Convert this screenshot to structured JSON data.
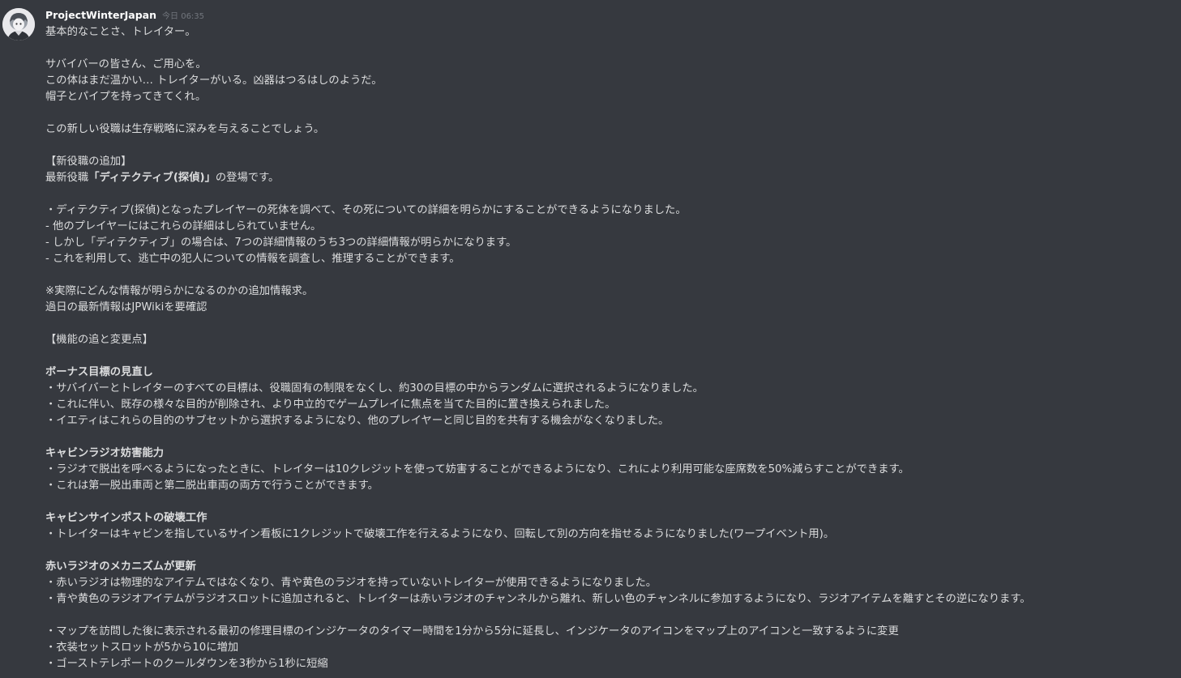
{
  "message": {
    "author": "ProjectWinterJapan",
    "timestamp": "今日 06:35",
    "lines": [
      {
        "text": "基本的なことさ、トレイター。"
      },
      {
        "text": ""
      },
      {
        "text": "サバイバーの皆さん、ご用心を。"
      },
      {
        "text": "この体はまだ温かい… トレイターがいる。凶器はつるはしのようだ。"
      },
      {
        "text": "帽子とパイプを持ってきてくれ。"
      },
      {
        "text": ""
      },
      {
        "text": "この新しい役職は生存戦略に深みを与えることでしょう。"
      },
      {
        "text": ""
      },
      {
        "text": "【新役職の追加】"
      },
      {
        "parts": [
          {
            "text": "最新役職"
          },
          {
            "text": "「ディテクティブ(探偵)」",
            "bold": true
          },
          {
            "text": "の登場です。"
          }
        ]
      },
      {
        "text": ""
      },
      {
        "text": "・ディテクティブ(探偵)となったプレイヤーの死体を調べて、その死についての詳細を明らかにすることができるようになりました。"
      },
      {
        "text": "- 他のプレイヤーにはこれらの詳細はしられていません。"
      },
      {
        "text": "- しかし「ディテクティブ」の場合は、7つの詳細情報のうち3つの詳細情報が明らかになります。"
      },
      {
        "text": "- これを利用して、逃亡中の犯人についての情報を調査し、推理することができます。"
      },
      {
        "text": ""
      },
      {
        "text": "※実際にどんな情報が明らかになるのかの追加情報求。"
      },
      {
        "text": "過日の最新情報はJPWikiを要確認"
      },
      {
        "text": ""
      },
      {
        "text": "【機能の追と変更点】"
      },
      {
        "text": ""
      },
      {
        "text": "ボーナス目標の見直し",
        "bold": true
      },
      {
        "text": "・サバイバーとトレイターのすべての目標は、役職固有の制限をなくし、約30の目標の中からランダムに選択されるようになりました。"
      },
      {
        "text": "・これに伴い、既存の様々な目的が削除され、より中立的でゲームプレイに焦点を当てた目的に置き換えられました。"
      },
      {
        "text": "・イエティはこれらの目的のサブセットから選択するようになり、他のプレイヤーと同じ目的を共有する機会がなくなりました。"
      },
      {
        "text": ""
      },
      {
        "text": "キャビンラジオ妨害能力",
        "bold": true
      },
      {
        "text": "・ラジオで脱出を呼べるようになったときに、トレイターは10クレジットを使って妨害することができるようになり、これにより利用可能な座席数を50%減らすことができます。"
      },
      {
        "text": "・これは第一脱出車両と第二脱出車両の両方で行うことができます。"
      },
      {
        "text": ""
      },
      {
        "text": "キャビンサインポストの破壊工作",
        "bold": true
      },
      {
        "text": "・トレイターはキャビンを指しているサイン看板に1クレジットで破壊工作を行えるようになり、回転して別の方向を指せるようになりました(ワープイベント用)。"
      },
      {
        "text": ""
      },
      {
        "text": "赤いラジオのメカニズムが更新",
        "bold": true
      },
      {
        "text": "・赤いラジオは物理的なアイテムではなくなり、青や黄色のラジオを持っていないトレイターが使用できるようになりました。"
      },
      {
        "text": "・青や黄色のラジオアイテムがラジオスロットに追加されると、トレイターは赤いラジオのチャンネルから離れ、新しい色のチャンネルに参加するようになり、ラジオアイテムを離すとその逆になります。"
      },
      {
        "text": ""
      },
      {
        "text": "・マップを訪問した後に表示される最初の修理目標のインジケータのタイマー時間を1分から5分に延長し、インジケータのアイコンをマップ上のアイコンと一致するように変更"
      },
      {
        "text": "・衣装セットスロットが5から10に増加"
      },
      {
        "text": "・ゴーストテレポートのクールダウンを3秒から1秒に短縮"
      }
    ]
  },
  "icons": {
    "avatar": "avatar-icon"
  },
  "colors": {
    "background": "#36393f",
    "username": "#ffffff",
    "text": "#dcddde",
    "timestamp": "#72767d"
  }
}
